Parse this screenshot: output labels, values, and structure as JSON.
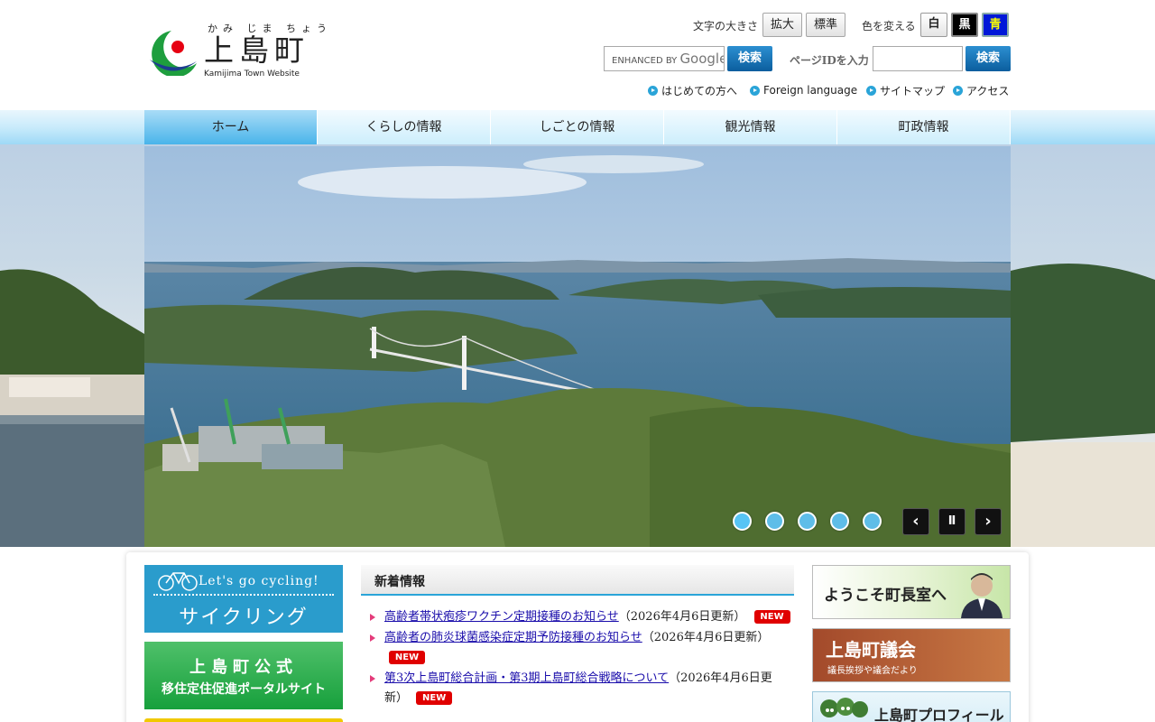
{
  "header": {
    "logo": {
      "ruby": "かみ じま ちょう",
      "title": "上島町",
      "subtitle": "Kamijima Town Website"
    },
    "font_size": {
      "label": "文字の大きさ",
      "enlarge": "拡大",
      "standard": "標準"
    },
    "color_change": {
      "label": "色を変える",
      "white": "白",
      "black": "黒",
      "blue": "青"
    },
    "search": {
      "placeholder_brand": "ENHANCED BY",
      "placeholder_google": "Google",
      "button": "検索"
    },
    "page_id": {
      "label": "ページIDを入力",
      "value": "",
      "button": "検索"
    },
    "links": [
      "はじめての方へ",
      "Foreign language",
      "サイトマップ",
      "アクセス"
    ]
  },
  "nav": {
    "items": [
      "ホーム",
      "くらしの情報",
      "しごとの情報",
      "観光情報",
      "町政情報"
    ],
    "active_index": 0
  },
  "slideshow": {
    "slide_count": 5,
    "current": 1,
    "prev": "‹",
    "pause": "Ⅱ",
    "next": "›"
  },
  "left_banners": {
    "cycling": {
      "english": "Let's go cycling!",
      "japanese": "サイクリング"
    },
    "iju": {
      "line1": "上島町公式",
      "line2": "移住定住促進ポータルサイト"
    }
  },
  "news": {
    "heading": "新着情報",
    "new_label": "NEW",
    "items": [
      {
        "title": "高齢者帯状疱疹ワクチン定期接種のお知らせ",
        "date": "（2026年4月6日更新）",
        "is_new": true
      },
      {
        "title": "高齢者の肺炎球菌感染症定期予防接種のお知らせ",
        "date": "（2026年4月6日更新）",
        "is_new": true
      },
      {
        "title": "第3次上島町総合計画・第3期上島町総合戦略について",
        "date": "（2026年4月6日更新）",
        "is_new": true
      }
    ]
  },
  "right_banners": {
    "mayor": "ようこそ町長室へ",
    "council": {
      "title": "上島町議会",
      "subtitle": "議長挨拶や議会だより"
    },
    "profile": "上島町プロフィール"
  },
  "colors": {
    "accent_blue": "#2aa4d8",
    "button_blue": "#0b5e9e",
    "new_red": "#e00000",
    "logo_green": "#1e9e3e",
    "logo_navy": "#1d3d8f",
    "logo_red": "#e60012"
  }
}
